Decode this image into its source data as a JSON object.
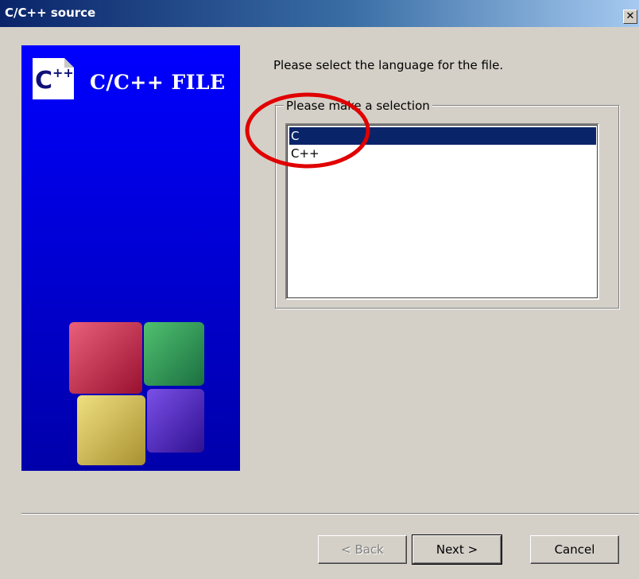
{
  "window": {
    "title": "C/C++ source",
    "close_symbol": "✕"
  },
  "banner": {
    "title": "C/C++ FILE",
    "logo_icon": "cpp-file-icon",
    "art_icon": "code-blocks-cubes-icon",
    "background_color": "#0000ff"
  },
  "page": {
    "instruction": "Please select the language for the file.",
    "group_label": "Please make a selection"
  },
  "language_list": {
    "items": [
      "C",
      "C++"
    ],
    "selected": "C"
  },
  "buttons": {
    "back": "< Back",
    "next": "Next >",
    "cancel": "Cancel"
  },
  "annotation": {
    "color": "#e00000"
  }
}
